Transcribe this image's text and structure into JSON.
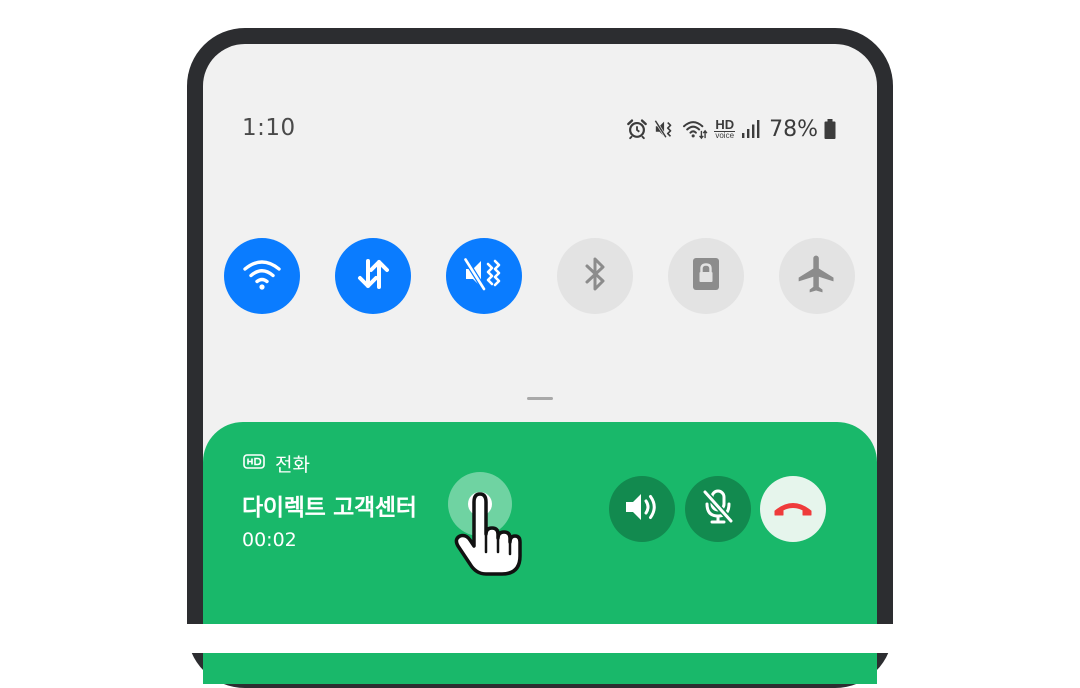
{
  "status_bar": {
    "time": "1:10",
    "battery": "78%",
    "icons": [
      "alarm-icon",
      "vibrate-icon",
      "wifi-calling-icon",
      "hd-voice-icon",
      "signal-icon",
      "battery-icon"
    ],
    "hd_label": "HD",
    "voice_label": "voice"
  },
  "quick_settings": [
    {
      "name": "wifi",
      "icon": "wifi-icon",
      "state": "on"
    },
    {
      "name": "mobile-data",
      "icon": "data-transfer-icon",
      "state": "on"
    },
    {
      "name": "vibrate",
      "icon": "vibrate-icon",
      "state": "on"
    },
    {
      "name": "bluetooth",
      "icon": "bluetooth-icon",
      "state": "off"
    },
    {
      "name": "rotation-lock",
      "icon": "lock-icon",
      "state": "off"
    },
    {
      "name": "airplane-mode",
      "icon": "airplane-icon",
      "state": "off"
    }
  ],
  "call": {
    "app_label": "전화",
    "caller_name": "다이렉트 고객센터",
    "duration": "00:02",
    "buttons": [
      "record-icon",
      "speaker-icon",
      "mute-icon",
      "end-call-icon"
    ]
  },
  "colors": {
    "toggle_on": "#0a7cff",
    "toggle_off": "#e3e3e3",
    "call_card": "#19b86a",
    "call_button_dark": "#128a4f",
    "end_call": "#ef3b3b"
  }
}
